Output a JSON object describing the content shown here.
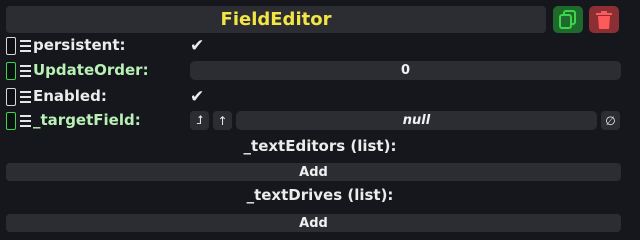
{
  "header": {
    "title": "FieldEditor",
    "duplicate_icon": "duplicate-icon",
    "delete_icon": "trash-icon"
  },
  "fields": [
    {
      "label": "persistent:",
      "checked": true
    },
    {
      "label": "UpdateOrder:",
      "value": "0"
    },
    {
      "label": "Enabled:",
      "checked": true
    },
    {
      "label": "_targetField:",
      "value": "null"
    }
  ],
  "lists": [
    {
      "title": "_textEditors (list):",
      "add_label": "Add"
    },
    {
      "title": "_textDrives (list):",
      "add_label": "Add"
    }
  ],
  "icons": {
    "check": "✔",
    "jump": "⮥",
    "up": "↑",
    "clear": "∅"
  },
  "colors": {
    "title": "#f4e547",
    "drive_green": "#3bd44a",
    "duplicate_bg": "#1e6a2c",
    "delete_bg": "#8c2f35"
  }
}
